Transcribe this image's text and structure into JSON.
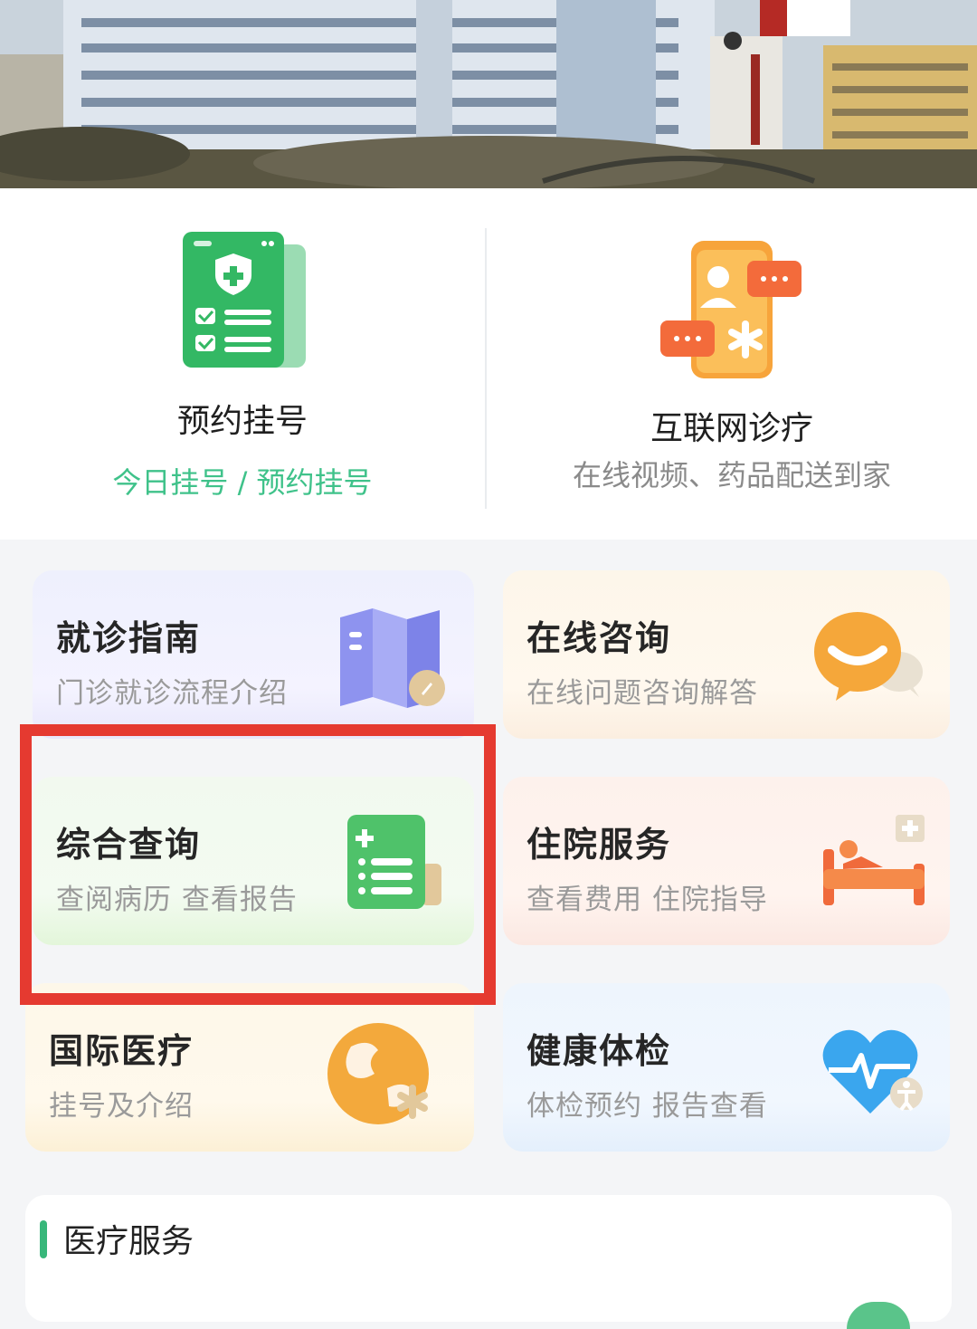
{
  "primary_actions": [
    {
      "title": "预约挂号",
      "subtitle": "今日挂号 / 预约挂号",
      "icon": "appointment-card-icon"
    },
    {
      "title": "互联网诊疗",
      "subtitle": "在线视频、药品配送到家",
      "icon": "online-consult-phone-icon"
    }
  ],
  "services": [
    {
      "title": "就诊指南",
      "subtitle": "门诊就诊流程介绍",
      "icon": "guide-map-icon"
    },
    {
      "title": "在线咨询",
      "subtitle": "在线问题咨询解答",
      "icon": "chat-bubble-icon"
    },
    {
      "title": "综合查询",
      "subtitle": "查阅病历 查看报告",
      "icon": "record-list-icon"
    },
    {
      "title": "住院服务",
      "subtitle": "查看费用 住院指导",
      "icon": "hospital-bed-icon"
    },
    {
      "title": "国际医疗",
      "subtitle": "挂号及介绍",
      "icon": "globe-icon"
    },
    {
      "title": "健康体检",
      "subtitle": "体检预约 报告查看",
      "icon": "heart-pulse-icon"
    }
  ],
  "section": {
    "title": "医疗服务"
  },
  "colors": {
    "accent_green": "#3fc28a",
    "highlight_red": "#e53a30"
  }
}
